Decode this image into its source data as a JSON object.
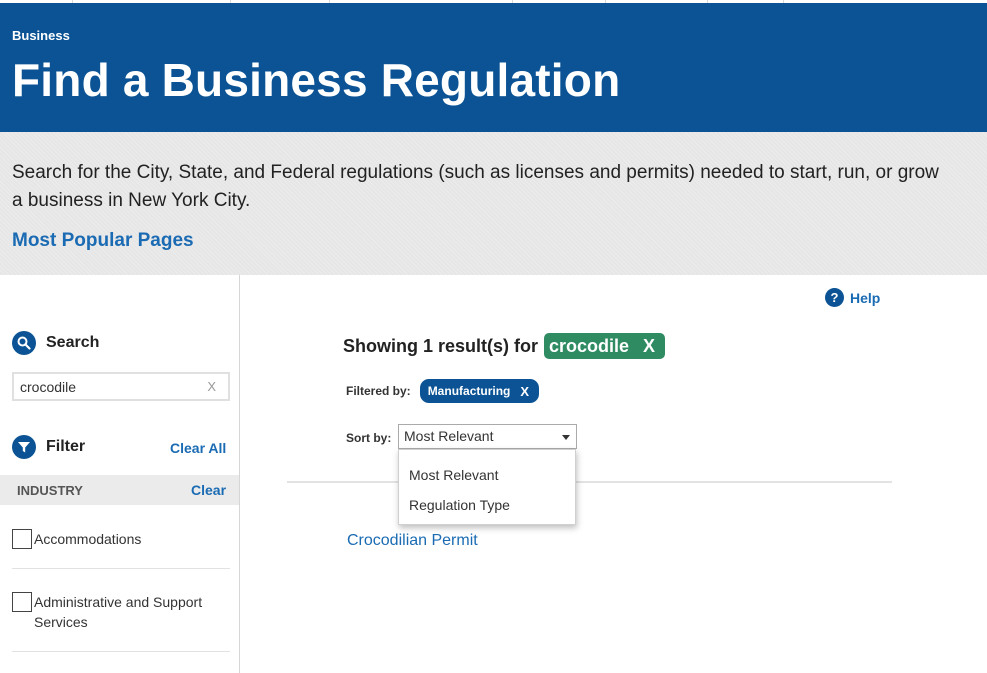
{
  "header": {
    "eyebrow": "Business",
    "title": "Find a Business Regulation"
  },
  "intro": {
    "description": "Search for the City, State, and Federal regulations (such as licenses and permits) needed to start, run, or grow a business in New York City.",
    "popular_link": "Most Popular Pages"
  },
  "sidebar": {
    "search_label": "Search",
    "search_value": "crocodile",
    "search_clear": "X",
    "filter_label": "Filter",
    "clear_all": "Clear All",
    "industry_label": "INDUSTRY",
    "industry_clear": "Clear",
    "industries": [
      {
        "label": "Accommodations",
        "checked": false
      },
      {
        "label": "Administrative and Support Services",
        "checked": false
      }
    ]
  },
  "main": {
    "help": "Help",
    "showing": "Showing 1 result(s) for",
    "search_term": "crocodile",
    "term_remove": "X",
    "filtered_by": "Filtered by:",
    "active_filter": "Manufacturing",
    "filter_remove": "X",
    "sort_by": "Sort by:",
    "sort_selected": "Most Relevant",
    "sort_options": [
      "Most Relevant",
      "Regulation Type"
    ],
    "results": [
      "Crocodilian Permit"
    ]
  },
  "colors": {
    "header_blue": "#0b5394",
    "link_blue": "#1a6bb3",
    "term_green": "#2e8b62",
    "intro_gray": "#e6e6e6"
  },
  "icons": [
    "search-icon",
    "filter-icon",
    "help-icon",
    "chevron-down-icon"
  ]
}
